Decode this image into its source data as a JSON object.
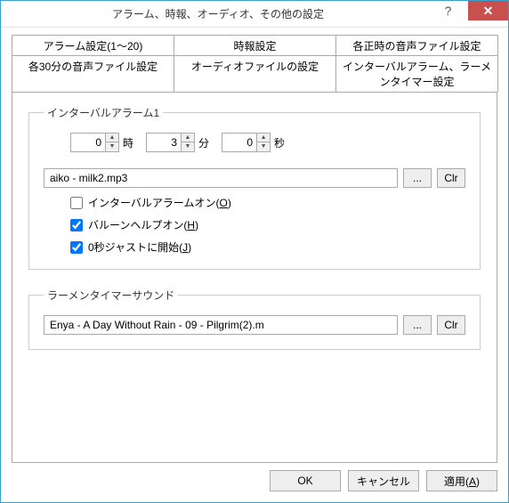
{
  "titlebar": {
    "title": "アラーム、時報、オーディオ、その他の設定",
    "help": "?",
    "close": "✕"
  },
  "tabs": {
    "row1": [
      "アラーム設定(1～20)",
      "時報設定",
      "各正時の音声ファイル設定"
    ],
    "row2": [
      "各30分の音声ファイル設定",
      "オーディオファイルの設定",
      "インターバルアラーム、ラーメンタイマー設定"
    ]
  },
  "interval": {
    "legend": "インターバルアラーム1",
    "hours": "0",
    "hours_label": "時",
    "minutes": "3",
    "minutes_label": "分",
    "seconds": "0",
    "seconds_label": "秒",
    "file": "aiko - milk2.mp3",
    "browse": "...",
    "clr": "Clr",
    "check1_label": "インターバルアラームオン(",
    "check1_key": "O",
    "check1_close": ")",
    "check2_label": "バルーンヘルプオン(",
    "check2_key": "H",
    "check2_close": ")",
    "check3_label": "0秒ジャストに開始(",
    "check3_key": "J",
    "check3_close": ")"
  },
  "ramen": {
    "legend": "ラーメンタイマーサウンド",
    "file": "Enya - A Day Without Rain - 09 - Pilgrim(2).m",
    "browse": "...",
    "clr": "Clr"
  },
  "buttons": {
    "ok": "OK",
    "cancel": "キャンセル",
    "apply_label": "適用(",
    "apply_key": "A",
    "apply_close": ")"
  }
}
